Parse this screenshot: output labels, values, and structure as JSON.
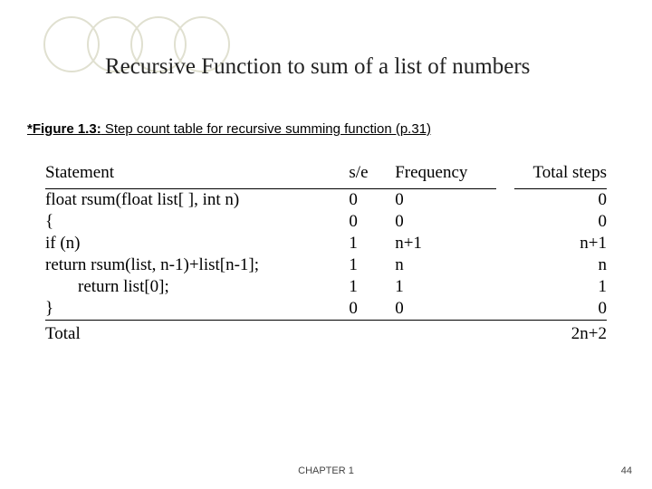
{
  "title": "Recursive Function to sum of a list of numbers",
  "caption": {
    "figlabel": "*Figure 1.3:",
    "rest": " Step count table for recursive summing function (p.31)"
  },
  "headers": {
    "stmt": "Statement",
    "se": "s/e",
    "freq": "Frequency",
    "tot": "Total steps"
  },
  "rows": [
    {
      "stmt": "float rsum(float list[ ], int n)",
      "se": "0",
      "freq": "0",
      "tot": "0",
      "indent": false
    },
    {
      "stmt": "{",
      "se": "0",
      "freq": "0",
      "tot": "0",
      "indent": false
    },
    {
      "stmt": "if (n)",
      "se": "1",
      "freq": "n+1",
      "tot": "n+1",
      "indent": false
    },
    {
      "stmt": "return rsum(list, n-1)+list[n-1];",
      "se": "1",
      "freq": "n",
      "tot": "n",
      "indent": false
    },
    {
      "stmt": "return list[0];",
      "se": "1",
      "freq": "1",
      "tot": "1",
      "indent": true
    },
    {
      "stmt": "}",
      "se": "0",
      "freq": "0",
      "tot": "0",
      "indent": false
    }
  ],
  "total": {
    "label": "Total",
    "value": "2n+2"
  },
  "footer": {
    "chapter": "CHAPTER 1",
    "page": "44"
  }
}
